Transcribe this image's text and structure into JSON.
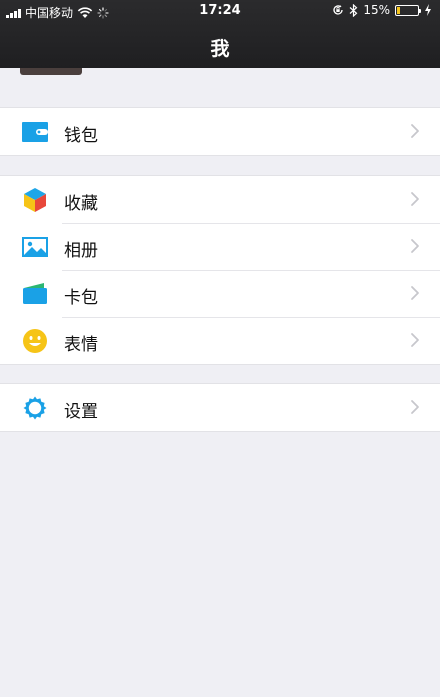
{
  "status_bar": {
    "carrier": "中国移动",
    "time": "17:24",
    "battery_text": "15%",
    "battery_level": 0.15,
    "battery_color": "#f7c61e"
  },
  "header": {
    "title": "我"
  },
  "menu": {
    "wallet": {
      "label": "钱包",
      "icon": "wallet-icon",
      "color": "#1aa1e6"
    },
    "favorites": {
      "label": "收藏",
      "icon": "cube-icon"
    },
    "album": {
      "label": "相册",
      "icon": "photo-icon",
      "color": "#1aa1e6"
    },
    "cards": {
      "label": "卡包",
      "icon": "card-icon",
      "color": "#1aa1e6"
    },
    "stickers": {
      "label": "表情",
      "icon": "smiley-icon",
      "color": "#f6c417"
    },
    "settings": {
      "label": "设置",
      "icon": "gear-icon",
      "color": "#1aa1e6"
    }
  },
  "colors": {
    "background": "#efeff4",
    "header": "#262628",
    "accent": "#1aa1e6",
    "chevron": "#c7c7cc"
  }
}
